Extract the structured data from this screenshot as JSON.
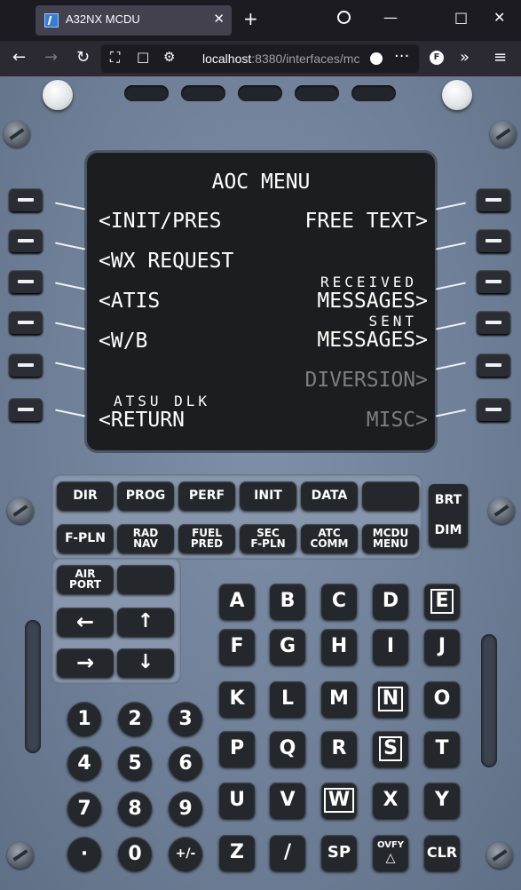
{
  "browser": {
    "tab_title": "A32NX MCDU",
    "tab_close": "✕",
    "new_tab": "+",
    "url_host": "localhost",
    "url_rest": ":8380/interfaces/mc",
    "extension_letter": "F",
    "icons": [
      "back-icon",
      "forward-icon",
      "reload-icon",
      "shield-icon",
      "page-icon",
      "permissions-icon",
      "more-icon",
      "extension-icon",
      "overflow-icon",
      "menu-icon",
      "alarm-icon"
    ]
  },
  "screen": {
    "title": "AOC MENU",
    "left": [
      {
        "small": "",
        "big": "<INIT/PRES",
        "color": "white"
      },
      {
        "small": "",
        "big": "<WX REQUEST",
        "color": "white"
      },
      {
        "small": "",
        "big": "<ATIS",
        "color": "white"
      },
      {
        "small": "",
        "big": "<W/B",
        "color": "white"
      },
      {
        "small": "",
        "big": "",
        "color": "white"
      },
      {
        "small": "ATSU DLK",
        "big": "<RETURN",
        "color": "white"
      }
    ],
    "right": [
      {
        "small": "",
        "big": "FREE TEXT>",
        "color": "white"
      },
      {
        "small": "",
        "big": "",
        "color": "white"
      },
      {
        "small": "RECEIVED",
        "big": "MESSAGES>",
        "color": "white"
      },
      {
        "small": "SENT",
        "big": "MESSAGES>",
        "color": "white"
      },
      {
        "small": "",
        "big": "DIVERSION>",
        "color": "gray"
      },
      {
        "small": "",
        "big": "MISC>",
        "color": "gray"
      }
    ],
    "colors": {
      "white": "#ffffff",
      "gray": "#7d7e80",
      "screen": "#1c1d20"
    }
  },
  "function_keys": {
    "row1": [
      "DIR",
      "PROG",
      "PERF",
      "INIT",
      "DATA",
      ""
    ],
    "row2": [
      "F-PLN",
      "RAD NAV",
      "FUEL PRED",
      "SEC F-PLN",
      "ATC COMM",
      "MCDU MENU"
    ],
    "airport": "AIR PORT",
    "brt": "BRT",
    "dim": "DIM"
  },
  "arrows": [
    "←",
    "↑",
    "→",
    "↓"
  ],
  "letters": [
    "A",
    "B",
    "C",
    "D",
    "E",
    "F",
    "G",
    "H",
    "I",
    "J",
    "K",
    "L",
    "M",
    "N",
    "O",
    "P",
    "Q",
    "R",
    "S",
    "T",
    "U",
    "V",
    "W",
    "X",
    "Y",
    "Z",
    "/",
    "SP",
    "OVFY",
    "CLR"
  ],
  "numbers": [
    "1",
    "2",
    "3",
    "4",
    "5",
    "6",
    "7",
    "8",
    "9",
    "·",
    "0",
    "+/-"
  ]
}
